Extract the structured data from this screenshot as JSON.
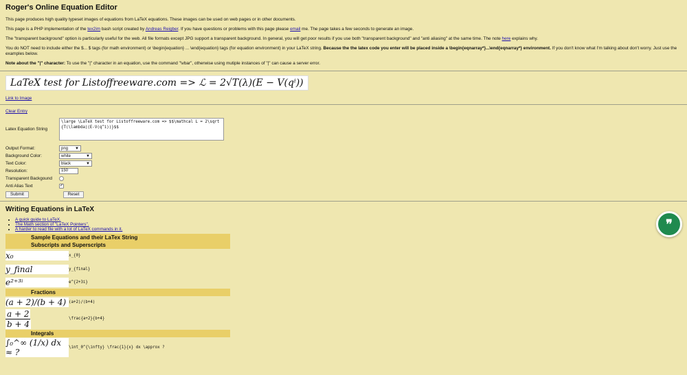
{
  "title": "Roger's Online Equation Editor",
  "paragraphs": {
    "p1": "This page produces high quality typeset images of equations from LaTeX equations. These images can be used on web pages or in other documents.",
    "p2_pre": "This page is a PHP implementation of the ",
    "p2_link1": "tex2im",
    "p2_mid": " bash script created by ",
    "p2_link2": "Andreas Reigber",
    "p2_mid2": ". If you have questions or problems with this page please ",
    "p2_link3": "email",
    "p2_post": " me. The page takes a few seconds to generate an image.",
    "p3_pre": "The \"transparent background\" option is particularly useful for the web. All file formats except JPG support a transparent background. In general, you will get poor results if you use both \"transparent background\" and \"anti aliasing\" at the same time. The note ",
    "p3_link": "here",
    "p3_post": " explains why.",
    "p4_pre": "You do NOT need to include either the $... $ tags (for math environment) or \\begin{equation} ... \\end{equation} tags (for equation environment) in your LaTeX string. ",
    "p4_bold": "Because the the latex code you enter will be placed inside a \\begin{eqnarray*}...\\end{eqnarray*} environment.",
    "p4_post": " If you don't know what I'm talking about don't worry. Just use the examples below.",
    "p5_bold": "Note about the \"|\" character:",
    "p5_post": " To use the \"|\" character in an equation, use the command \"\\vbar\", otherwise using mutiple instances of \"|\" can cause a server error."
  },
  "rendered_equation": "LaTeX test for Listoffreeware.com => ℒ = 2√T(λ)(E − V(qⁱ))",
  "link_to_image": "Link to Image",
  "clear_entry": "Clear Entry",
  "form": {
    "latex_label": "Latex Equation String",
    "latex_value": "\\large \\LaTeX test for Listoffreeware.com => $$\\mathcal L = 2\\sqrt {T(\\lambda)(E-V(q^i))}$$",
    "output_format_label": "Output Format:",
    "output_format_value": "png",
    "background_color_label": "Background Color:",
    "background_color_value": "white",
    "text_color_label": "Text Color:",
    "text_color_value": "black",
    "resolution_label": "Resolution:",
    "resolution_value": "150",
    "transparent_label": "Transparent Backgound",
    "antialias_label": "Anti Alias Text",
    "submit_label": "Submit",
    "reset_label": "Reset"
  },
  "section_title": "Writing Equations in LaTeX",
  "guide_links": [
    "A quick guide to LaTeX.",
    "The Math section of \"LaTeX Pointers\".",
    "A harder to read file with a lot of LaTeX commands in it."
  ],
  "sample_table": {
    "header": "Sample Equations and their LaTex String",
    "sub1": "Subscripts and Superscripts",
    "rows1": [
      {
        "eq": "x₀",
        "code": "x_{0}"
      },
      {
        "eq": "y_final",
        "code": "y_{final}"
      },
      {
        "eq": "e²⁺³ⁱ",
        "code": "e^{2+3i}"
      }
    ],
    "sub2": "Fractions",
    "rows2": [
      {
        "eq": "(a + 2)/(b + 4)",
        "code": "(a+2)/(b+4)"
      },
      {
        "eq_num": "a + 2",
        "eq_den": "b + 4",
        "code": "\\frac{a+2}{b+4}"
      }
    ],
    "sub3": "Integrals",
    "rows3": [
      {
        "eq": "∫₀^∞ (1/x) dx ≈ ?",
        "code": "\\int_0^{\\infty} \\frac{1}{x} dx \\approx ?"
      }
    ]
  },
  "fab_icon": "quote-icon",
  "colors": {
    "page_bg": "#efe7b0",
    "band": "#e9cf68",
    "fab": "#1f8a4f"
  }
}
